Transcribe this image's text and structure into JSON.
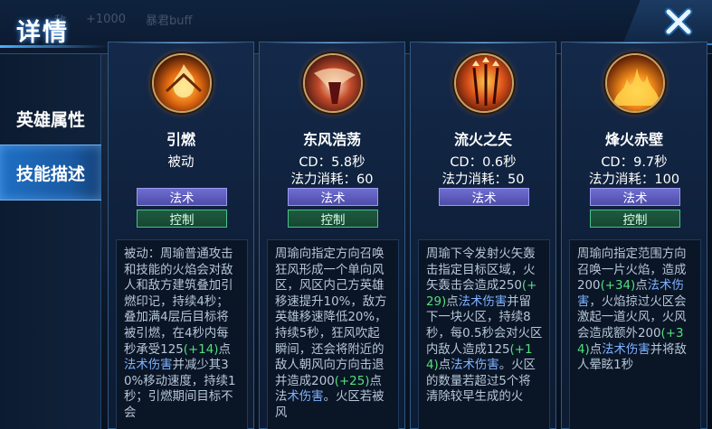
{
  "header": {
    "title": "详情"
  },
  "background": {
    "strip": [
      "敌",
      "+1000",
      "暴君buff"
    ]
  },
  "sidebar": {
    "items": [
      {
        "label": "英雄属性",
        "active": false
      },
      {
        "label": "技能描述",
        "active": true
      }
    ]
  },
  "colors": {
    "accent_blue": "#1f6fc4",
    "magic_tag": "#5d5cc0",
    "control_tag": "#48c28a",
    "value_green": "#52e07a",
    "damage_blue": "#7fb2ff"
  },
  "skills": [
    {
      "name": "引燃",
      "icon": "flame-fan-icon",
      "line1": "被动",
      "line2": "",
      "tags": [
        "法术",
        "控制"
      ],
      "desc_parts": [
        {
          "text": "被动：周瑜普通攻击和技能的火焰会对敌人和敌方建筑叠加引燃印记，持续4秒；叠加满4层后目标将被引燃，在4秒内每秒承受125",
          "style": "plain"
        },
        {
          "text": "(+14)",
          "style": "green"
        },
        {
          "text": "点",
          "style": "plain"
        },
        {
          "text": "法术伤害",
          "style": "blue"
        },
        {
          "text": "并减少其30%移动速度，持续1秒；引燃期间目标不会",
          "style": "plain"
        }
      ]
    },
    {
      "name": "东风浩荡",
      "icon": "east-wind-icon",
      "line1": "CD：5.8秒",
      "line2": "法力消耗：60",
      "tags": [
        "法术",
        "控制"
      ],
      "desc_parts": [
        {
          "text": "周瑜向指定方向召唤狂风形成一个单向风区，风区内己方英雄移速提升10%，敌方英雄移速降低20%，持续5秒，狂风吹起瞬间，还会将附近的敌人朝风向方向击退并造成200",
          "style": "plain"
        },
        {
          "text": "(+25)",
          "style": "green"
        },
        {
          "text": "点法",
          "style": "plain"
        },
        {
          "text": "术伤害",
          "style": "blue"
        },
        {
          "text": "。火区若被风",
          "style": "plain"
        }
      ]
    },
    {
      "name": "流火之矢",
      "icon": "fire-arrow-icon",
      "line1": "CD：0.6秒",
      "line2": "法力消耗：50",
      "tags": [
        "法术"
      ],
      "desc_parts": [
        {
          "text": "周瑜下令发射火矢轰击指定目标区域，火矢轰击会造成250",
          "style": "plain"
        },
        {
          "text": "(+29)",
          "style": "green"
        },
        {
          "text": "点",
          "style": "plain"
        },
        {
          "text": "法术伤害",
          "style": "blue"
        },
        {
          "text": "并留下一块火区，持续8秒，每0.5秒会对火区内敌人造成125",
          "style": "plain"
        },
        {
          "text": "(+14)",
          "style": "green"
        },
        {
          "text": "点",
          "style": "plain"
        },
        {
          "text": "法术伤害",
          "style": "blue"
        },
        {
          "text": "。火区的数量若超过5个将清除较早生成的火",
          "style": "plain"
        }
      ]
    },
    {
      "name": "烽火赤壁",
      "icon": "fire-wall-icon",
      "line1": "CD：9.7秒",
      "line2": "法力消耗：100",
      "tags": [
        "法术",
        "控制"
      ],
      "desc_parts": [
        {
          "text": "周瑜向指定范围方向召唤一片火焰，造成200",
          "style": "plain"
        },
        {
          "text": "(+34)",
          "style": "green"
        },
        {
          "text": "点",
          "style": "plain"
        },
        {
          "text": "法术伤害",
          "style": "blue"
        },
        {
          "text": "，火焰掠过火区会激起一道火风，火风会造成额外200",
          "style": "plain"
        },
        {
          "text": "(+34)",
          "style": "green"
        },
        {
          "text": "点",
          "style": "plain"
        },
        {
          "text": "法术伤害",
          "style": "blue"
        },
        {
          "text": "并将敌人晕眩1秒",
          "style": "plain"
        }
      ]
    }
  ]
}
